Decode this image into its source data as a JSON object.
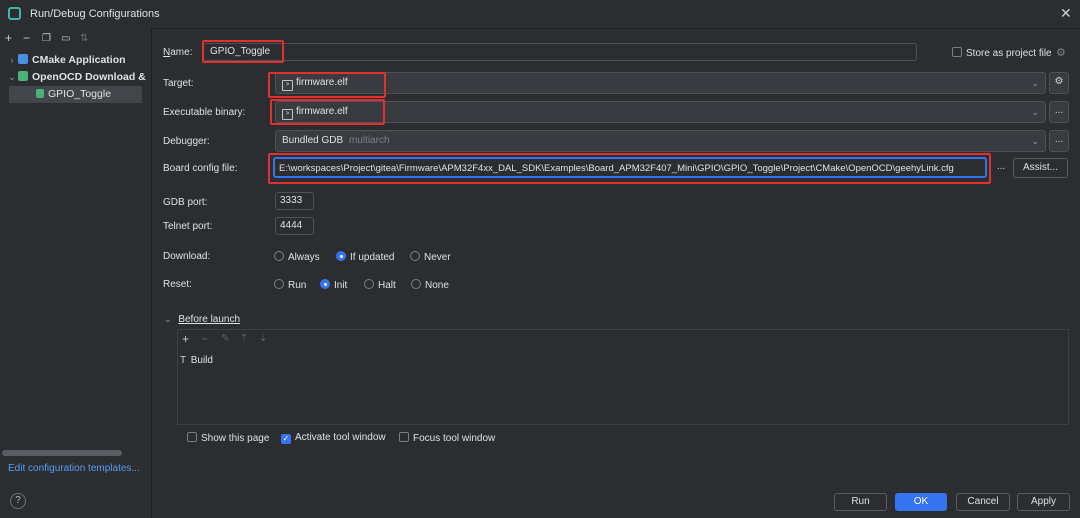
{
  "window": {
    "title": "Run/Debug Configurations"
  },
  "tree": {
    "items": [
      {
        "label": "CMake Application",
        "color": "#4a90e2"
      },
      {
        "label": "OpenOCD Download &",
        "color": "#47b37a"
      },
      {
        "label": "GPIO_Toggle",
        "color": "#47b37a"
      }
    ],
    "edit_templates_link": "Edit configuration templates..."
  },
  "form": {
    "name_label": "Name:",
    "name_value": "GPIO_Toggle",
    "store_label": "Store as project file",
    "target_label": "Target:",
    "target_value": "firmware.elf",
    "exec_label": "Executable binary:",
    "exec_value": "firmware.elf",
    "debugger_label": "Debugger:",
    "debugger_value": "Bundled GDB",
    "debugger_hint": "multiarch",
    "board_label": "Board config file:",
    "board_value": "E:\\workspaces\\Project\\gitea\\Firmware\\APM32F4xx_DAL_SDK\\Examples\\Board_APM32F407_Mini\\GPIO\\GPIO_Toggle\\Project\\CMake\\OpenOCD\\geehyLink.cfg",
    "ellipsis": "...",
    "assist_label": "Assist...",
    "gdb_port_label": "GDB port:",
    "gdb_port_value": "3333",
    "telnet_port_label": "Telnet port:",
    "telnet_port_value": "4444",
    "download_label": "Download:",
    "download_options": [
      "Always",
      "If updated",
      "Never"
    ],
    "reset_label": "Reset:",
    "reset_options": [
      "Run",
      "Init",
      "Halt",
      "None"
    ]
  },
  "before_launch": {
    "title": "Before launch",
    "tasks": [
      "Build"
    ]
  },
  "options": {
    "show_page": "Show this page",
    "activate_tool": "Activate tool window",
    "focus_tool": "Focus tool window"
  },
  "buttons": {
    "run": "Run",
    "ok": "OK",
    "cancel": "Cancel",
    "apply": "Apply"
  },
  "colors": {
    "accent": "#3574f0",
    "highlight_box": "#e03030",
    "link": "#589df6"
  }
}
